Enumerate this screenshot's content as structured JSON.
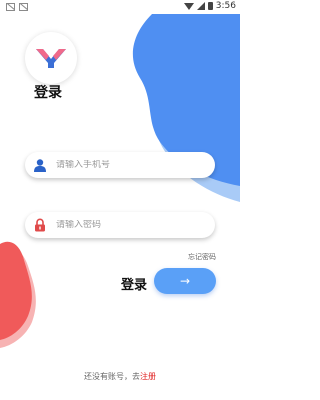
{
  "status_bar": {
    "time": "3:56",
    "left_icons": [
      "notification-icon",
      "notification-icon"
    ],
    "right_icons": [
      "wifi-icon",
      "signal-icon",
      "battery-icon"
    ]
  },
  "header": {
    "title": "登录"
  },
  "form": {
    "phone_placeholder": "请输入手机号",
    "password_placeholder": "请输入密码",
    "forgot_label": "忘记密码"
  },
  "login": {
    "label": "登录",
    "arrow": "→"
  },
  "footer": {
    "prompt": "还没有账号，去",
    "signup_link": "注册"
  },
  "colors": {
    "accent_blue": "#5aa0f7",
    "shadow_blue": "#9ec5f8",
    "accent_red": "#f05a5a",
    "user_icon": "#2a62c8",
    "lock_icon": "#e04a4a",
    "link_red": "#e02020"
  }
}
